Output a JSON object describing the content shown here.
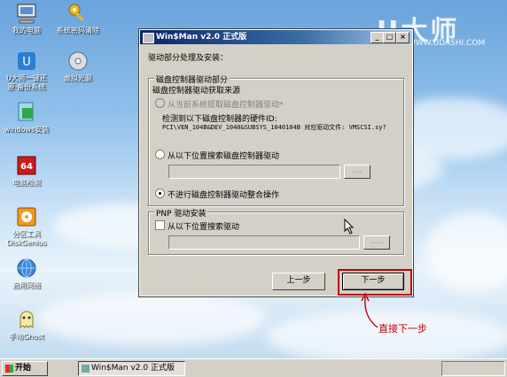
{
  "desktop": {
    "icons": [
      {
        "label": "我的电脑",
        "icon": "my-computer-icon"
      },
      {
        "label": "系统密码清除",
        "icon": "key-icon"
      },
      {
        "label": "U大师一键还\n原·备份系统",
        "icon": "backup-icon"
      },
      {
        "label": "虚拟光驱",
        "icon": "cd-drive-icon"
      },
      {
        "label": "windows安装",
        "icon": "windows-install-icon"
      },
      {
        "label": "电脑检测",
        "icon": "cpu64-icon"
      },
      {
        "label": "分区工具\nDiskGenius",
        "icon": "diskgenius-icon"
      },
      {
        "label": "启用网络",
        "icon": "network-icon"
      },
      {
        "label": "手动Ghost",
        "icon": "ghost-icon"
      }
    ],
    "brand_text": "U大师",
    "brand_url": "WWW.UDASHI.COM"
  },
  "window": {
    "title": "Win$Man v2.0 正式版",
    "subtitle": "驱动部分处理及安装：",
    "disk_group": {
      "title": "磁盘控制器驱动部分",
      "source_label": "磁盘控制器驱动获取来源",
      "option1": "从当前系统提取磁盘控制器驱动*",
      "detected_line1": "检测到以下磁盘控制器的硬件ID:",
      "detected_line2": "PCI\\VEN_104B&DEV_1040&SUBSYS_1040104B 对应驱动文件: VMSCSI.sy?",
      "option2": "从以下位置搜索磁盘控制器驱动",
      "option3": "不进行磁盘控制器驱动整合操作",
      "selected": "option3",
      "browse": "...."
    },
    "pnp_group": {
      "title": "PNP 驱动安装",
      "checkbox_label": "从以下位置搜索驱动",
      "checked": false,
      "browse": "....."
    },
    "prev_button": "上一步",
    "next_button": "下一步"
  },
  "annotation": "直接下一步",
  "taskbar": {
    "start_label": "开始",
    "task_label": "Win$Man v2.0 正式版"
  },
  "colors": {
    "accent_red": "#c00000",
    "title_blue": "#0a246a"
  }
}
